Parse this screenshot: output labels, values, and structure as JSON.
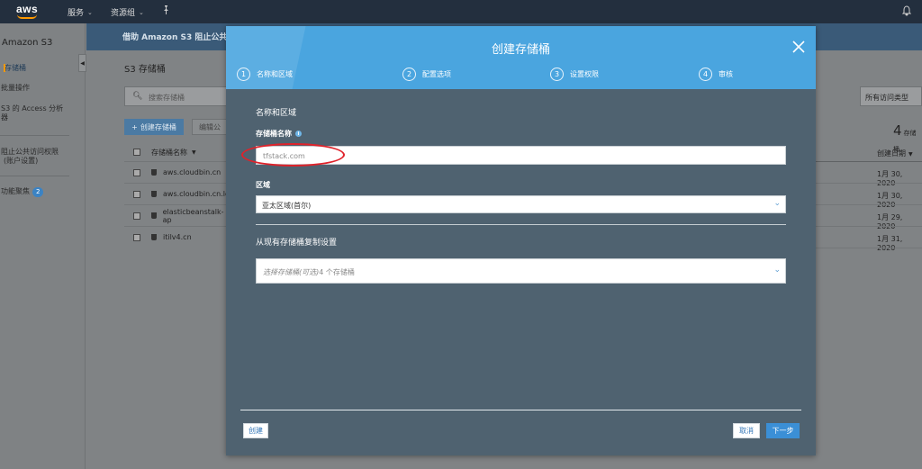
{
  "topnav": {
    "logo": "aws",
    "services": "服务",
    "resource_groups": "资源组",
    "pin_icon": "pin-icon",
    "bell_icon": "bell-icon"
  },
  "sidebar": {
    "title": "Amazon S3",
    "items": [
      {
        "label": "存储桶"
      },
      {
        "label": "批量操作"
      },
      {
        "label": "S3 的 Access 分析"
      },
      {
        "label": "器"
      },
      {
        "label": "阻止公共访问权限"
      },
      {
        "label": "(账户设置)"
      },
      {
        "label": "功能聚焦",
        "badge": "2"
      }
    ]
  },
  "main": {
    "banner": "借助 Amazon S3 阻止公共访",
    "title": "S3 存储桶",
    "search_placeholder": "搜索存储桶",
    "create_bucket": "创建存储桶",
    "edit_public": "编辑公",
    "col_name": "存储桶名称",
    "rows": [
      {
        "name": "aws.cloudbin.cn",
        "date": "1月 30, 2020"
      },
      {
        "name": "aws.cloudbin.cn.lo",
        "date": "1月 30, 2020"
      },
      {
        "name": "elasticbeanstalk-ap",
        "date": "1月 29, 2020"
      },
      {
        "name": "itilv4.cn",
        "date": "1月 31, 2020"
      }
    ],
    "access_filter": "所有访问类型",
    "count": "4",
    "count_unit": "存储桶",
    "col_date": "创建日期"
  },
  "modal": {
    "title": "创建存储桶",
    "steps": [
      {
        "num": "1",
        "label": "名称和区域"
      },
      {
        "num": "2",
        "label": "配置选项"
      },
      {
        "num": "3",
        "label": "设置权限"
      },
      {
        "num": "4",
        "label": "审核"
      }
    ],
    "section_title": "名称和区域",
    "bucket_name_label": "存储桶名称",
    "bucket_name_value": "tfstack.com",
    "region_label": "区域",
    "region_value": "亚太区域(首尔)",
    "copy_title": "从现有存储桶复制设置",
    "copy_placeholder_italic": "选择存储桶(可选)",
    "copy_placeholder_count": "4 个存储桶",
    "btn_create": "创建",
    "btn_cancel": "取消",
    "btn_next": "下一步",
    "accent": "#4aa5df",
    "annotation_color": "#e0222a"
  }
}
